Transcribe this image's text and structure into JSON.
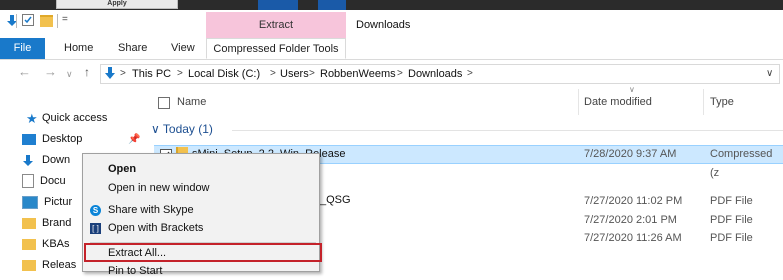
{
  "top": {
    "apply_label": "Apply"
  },
  "titlebar": {
    "extract_tab": "Extract",
    "window_title": "Downloads",
    "qat_menu": "="
  },
  "ribbon": {
    "file": "File",
    "home": "Home",
    "share": "Share",
    "view": "View",
    "compressed_tools": "Compressed Folder Tools"
  },
  "address": {
    "crumbs": [
      "This PC",
      "Local Disk (C:)",
      "Users",
      "RobbenWeems",
      "Downloads"
    ],
    "separator": ">",
    "dropdown": "∨"
  },
  "nav": {
    "quick_access": "Quick access",
    "items": [
      "Desktop",
      "Down",
      "Docu",
      "Pictur",
      "Brand",
      "KBAs",
      "Releas"
    ]
  },
  "columns": {
    "name": "Name",
    "date_modified": "Date modified",
    "type": "Type"
  },
  "groups": {
    "today": "Today (1)"
  },
  "files": [
    {
      "name": "sMini_Setup_2.2_Win_Release",
      "date": "7/28/2020 9:37 AM",
      "type": "Compressed (z"
    },
    {
      "name": "_QSG",
      "date": "7/27/2020 11:02 PM",
      "type": "PDF File"
    },
    {
      "name": "",
      "date": "7/27/2020 2:01 PM",
      "type": "PDF File"
    },
    {
      "name": "",
      "date": "7/27/2020 11:26 AM",
      "type": "PDF File"
    }
  ],
  "context_menu": {
    "open": "Open",
    "open_new_window": "Open in new window",
    "share_skype": "Share with Skype",
    "open_brackets": "Open with Brackets",
    "extract_all": "Extract All...",
    "pin_start": "Pin to Start"
  },
  "colors": {
    "accent": "#1979ca",
    "extract_tab_bg": "#f7c5db",
    "selection": "#cce8ff",
    "highlight_border": "#c4222a"
  }
}
